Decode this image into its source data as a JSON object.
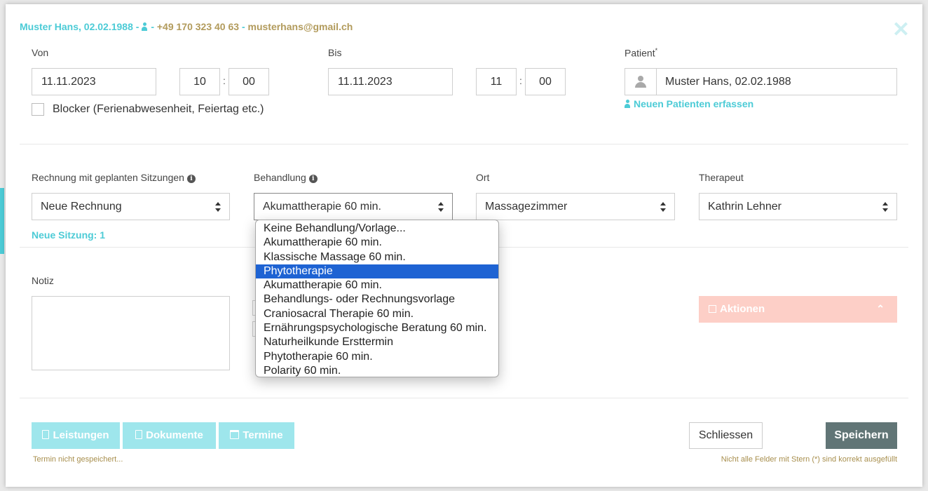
{
  "header": {
    "patient_info": "Muster Hans, 02.02.1988 -",
    "separator": "-",
    "phone": "+49 170 323 40 63",
    "separator2": "-",
    "email": "musterhans@gmail.ch",
    "close_symbol": "✕"
  },
  "von": {
    "label": "Von",
    "date": "11.11.2023",
    "hour": "10",
    "minute": "00"
  },
  "bis": {
    "label": "Bis",
    "date": "11.11.2023",
    "hour": "11",
    "minute": "00"
  },
  "time_colon": ":",
  "patient": {
    "label": "Patient",
    "required_mark": "*",
    "value": "Muster Hans, 02.02.1988",
    "new_patient_link": "Neuen Patienten erfassen"
  },
  "blocker": {
    "label": "Blocker (Ferienabwesenheit, Feiertag etc.)",
    "checked": false
  },
  "rechnung": {
    "label": "Rechnung mit geplanten Sitzungen",
    "value": "Neue Rechnung",
    "info_icon": "i",
    "new_session": "Neue Sitzung: 1"
  },
  "behandlung": {
    "label": "Behandlung",
    "info_icon": "i",
    "value": "Akumattherapie 60 min.",
    "options": [
      "Keine Behandlung/Vorlage...",
      "Akumattherapie 60 min.",
      "Klassische Massage 60 min.",
      "Phytotherapie",
      "Akumattherapie 60 min.",
      "Behandlungs- oder Rechnungsvorlage",
      "Craniosacral Therapie 60 min.",
      "Ernährungspsychologische Beratung 60 min.",
      "Naturheilkunde Ersttermin",
      "Phytotherapie 60 min.",
      "Polarity 60 min."
    ],
    "highlighted_option": "Phytotherapie"
  },
  "ort": {
    "label": "Ort",
    "value": "Massagezimmer"
  },
  "therapeut": {
    "label": "Therapeut",
    "value": "Kathrin Lehner"
  },
  "notiz": {
    "label": "Notiz",
    "value": ""
  },
  "aktionen": {
    "label": "Aktionen",
    "chevron": "⌃"
  },
  "footer": {
    "leistungen": "Leistungen",
    "dokumente": "Dokumente",
    "termine": "Termine",
    "status_left": "Termin nicht gespeichert...",
    "schliessen": "Schliessen",
    "speichern": "Speichern",
    "status_right": "Nicht alle Felder mit Stern (*) sind korrekt ausgefüllt"
  },
  "colors": {
    "teal": "#4ccbd6",
    "olive": "#b29b5c",
    "teal_button": "#9ee6ec",
    "aktionen_button": "#fdcfc7",
    "save_button": "#617576",
    "selected_option": "#1e63d3"
  }
}
